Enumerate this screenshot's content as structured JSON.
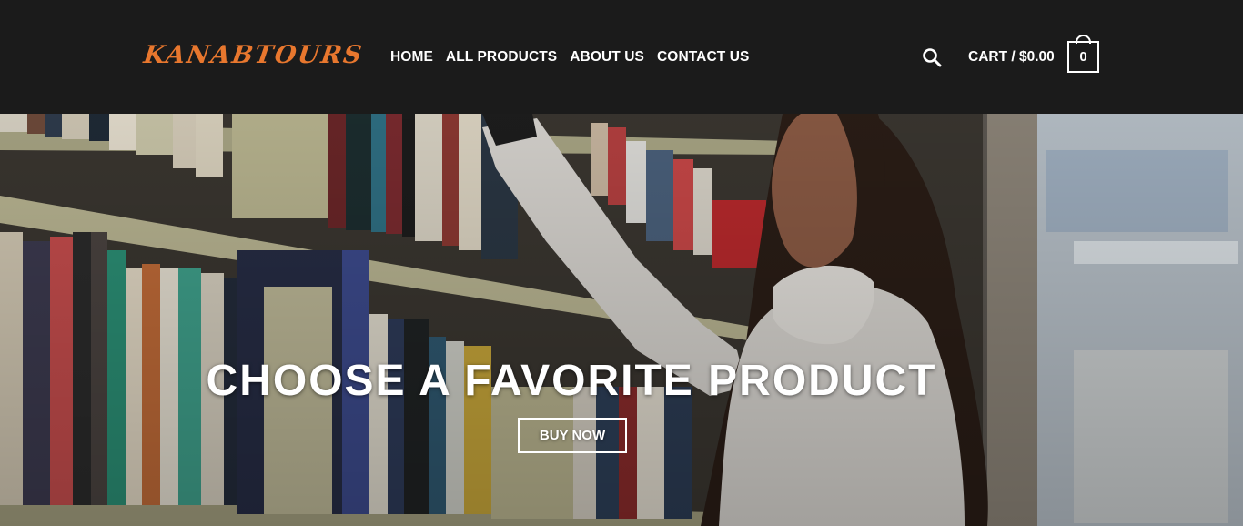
{
  "brand": {
    "logo_text": "KANABTOURS",
    "accent": "#e8772e"
  },
  "nav": {
    "items": [
      "HOME",
      "ALL PRODUCTS",
      "ABOUT US",
      "CONTACT US"
    ]
  },
  "header": {
    "search_icon": "search-icon",
    "cart_label": "CART / $0.00",
    "cart_count": "0"
  },
  "hero": {
    "title": "CHOOSE A FAVORITE PRODUCT",
    "button_label": "BUY NOW",
    "image": "photo of a woman reaching for a book on library shelves"
  },
  "colors": {
    "header_bg": "#1b1b1b",
    "text": "#ffffff"
  }
}
